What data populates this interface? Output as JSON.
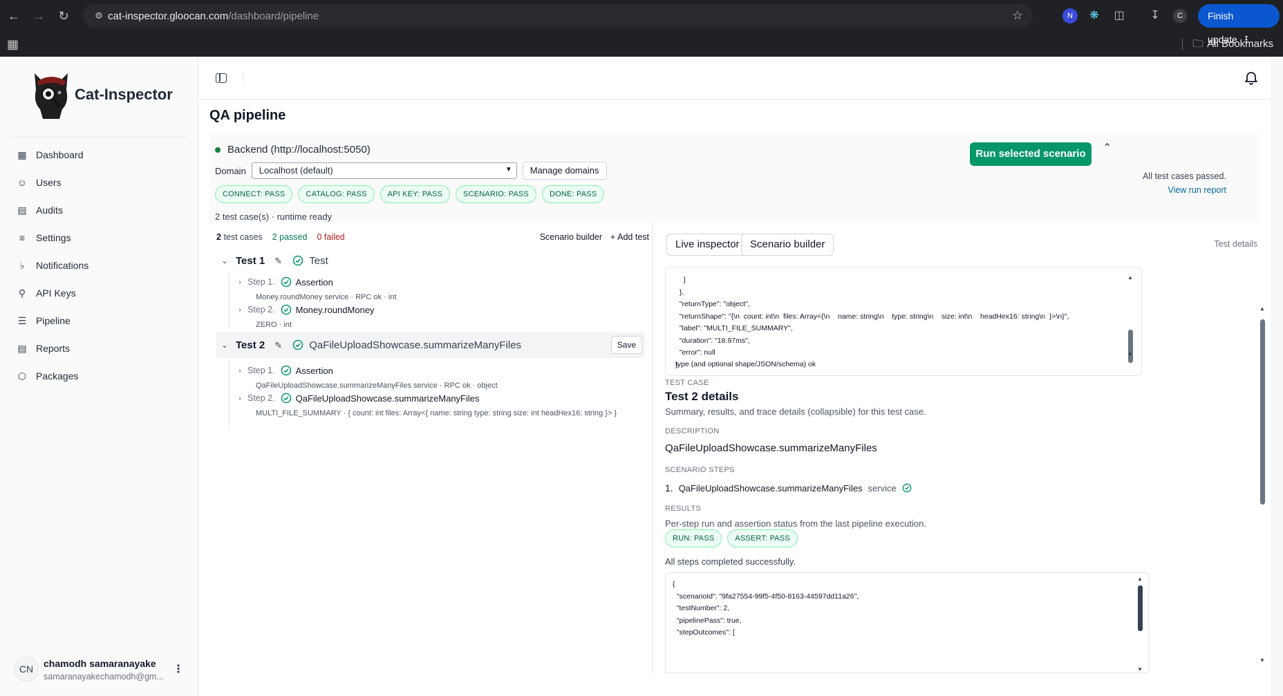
{
  "browser": {
    "url_host": "cat-inspector.gloocan.com",
    "url_path": "/dashboard/pipeline",
    "finish_update": "Finish update",
    "all_bookmarks": "All Bookmarks",
    "profile_letter": "C",
    "ext_n_letter": "N"
  },
  "sidebar": {
    "brand_prefix": "Cat-",
    "brand_suffix": "Inspector",
    "items": [
      {
        "label": "Dashboard",
        "icon": "dashboard-icon"
      },
      {
        "label": "Users",
        "icon": "users-icon"
      },
      {
        "label": "Audits",
        "icon": "audits-icon"
      },
      {
        "label": "Settings",
        "icon": "settings-icon"
      },
      {
        "label": "Notifications",
        "icon": "bell-icon"
      },
      {
        "label": "API Keys",
        "icon": "key-icon"
      },
      {
        "label": "Pipeline",
        "icon": "pipeline-icon"
      },
      {
        "label": "Reports",
        "icon": "reports-icon"
      },
      {
        "label": "Packages",
        "icon": "package-icon"
      }
    ],
    "user": {
      "initials": "CN",
      "name": "chamodh samaranayake",
      "email": "samaranayakechamodh@gm..."
    }
  },
  "page": {
    "title": "QA pipeline",
    "backend": "Backend (http://localhost:5050)",
    "domain_label": "Domain",
    "domain_value": "Localhost (default)",
    "manage_domains": "Manage domains",
    "badges": [
      "CONNECT: PASS",
      "CATALOG: PASS",
      "API KEY: PASS",
      "SCENARIO: PASS",
      "DONE: PASS"
    ],
    "runtime": "2 test case(s) · runtime ready",
    "run_button": "Run selected scenario",
    "passed_text": "All test cases passed.",
    "view_report": "View run report"
  },
  "tests": {
    "count": "2",
    "count_label": "test cases",
    "passed": "2 passed",
    "failed": "0 failed",
    "scenario_builder": "Scenario builder",
    "add_test": "+ Add test",
    "list": [
      {
        "name": "Test 1",
        "label": "Test",
        "steps": [
          {
            "no": "Step 1.",
            "title": "Assertion",
            "sub": "Money.roundMoney service · RPC ok · int"
          },
          {
            "no": "Step 2.",
            "title": "Money.roundMoney",
            "sub": "ZERO · int"
          }
        ]
      },
      {
        "name": "Test 2",
        "label": "QaFileUploadShowcase.summarizeManyFiles",
        "save": "Save",
        "steps": [
          {
            "no": "Step 1.",
            "title": "Assertion",
            "sub": "QaFileUploadShowcase.summarizeManyFiles service · RPC ok · object"
          },
          {
            "no": "Step 2.",
            "title": "QaFileUploadShowcase.summarizeManyFiles",
            "sub": "MULTI_FILE_SUMMARY · { count: int files: Array<{ name: string type: string size: int headHex16: string }> }"
          }
        ]
      }
    ]
  },
  "inspector": {
    "live_tab": "Live inspector",
    "builder_tab": "Scenario builder",
    "test_details": "Test details",
    "code_top": [
      "    ]",
      "  },",
      "  \"returnType\": \"object\",",
      "  \"returnShape\": \"{\\n  count: int\\n  files: Array<{\\n    name: string\\n    type: string\\n    size: int\\n    headHex16: string\\n  }>\\n}\",",
      "  \"label\": \"MULTI_FILE_SUMMARY\",",
      "  \"duration\": \"18.97ms\",",
      "  \"error\": null",
      "}"
    ],
    "code_tail": "type (and optional shape/JSON/schema) ok",
    "test_case_label": "TEST CASE",
    "details_title": "Test 2 details",
    "details_sub": "Summary, results, and trace details (collapsible) for this test case.",
    "description_label": "DESCRIPTION",
    "description": "QaFileUploadShowcase.summarizeManyFiles",
    "scenario_steps_label": "SCENARIO STEPS",
    "scenario_step_no": "1.",
    "scenario_step_name": "QaFileUploadShowcase.summarizeManyFiles",
    "scenario_step_kind": "service",
    "results_label": "RESULTS",
    "results_sub": "Per-step run and assertion status from the last pipeline execution.",
    "result_badges": [
      "RUN: PASS",
      "ASSERT: PASS"
    ],
    "all_steps": "All steps completed successfully.",
    "code_bottom": [
      "{",
      "  \"scenarioId\": \"9fa27554-99f5-4f50-8163-44597dd11a26\",",
      "  \"testNumber\": 2,",
      "  \"pipelinePass\": true,",
      "  \"stepOutcomes\": ["
    ]
  },
  "colors": {
    "accent_green": "#059669",
    "badge_border": "#86efac",
    "link_blue": "#0369a1",
    "fail_red": "#b91c1c"
  }
}
